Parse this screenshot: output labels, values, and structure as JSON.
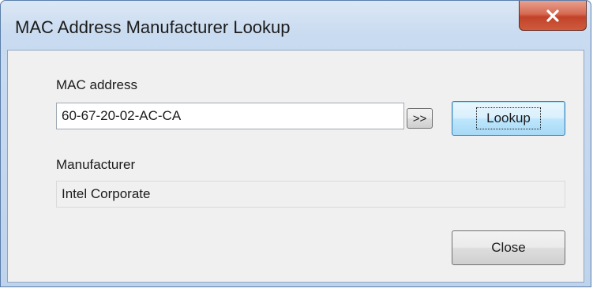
{
  "window": {
    "title": "MAC Address Manufacturer Lookup",
    "close_icon": "close-x-icon",
    "close_color": "#c7432a"
  },
  "form": {
    "mac_label": "MAC address",
    "mac_value": "60-67-20-02-AC-CA",
    "expand_label": ">>",
    "lookup_label": "Lookup",
    "manufacturer_label": "Manufacturer",
    "manufacturer_value": "Intel Corporate",
    "close_label": "Close"
  }
}
